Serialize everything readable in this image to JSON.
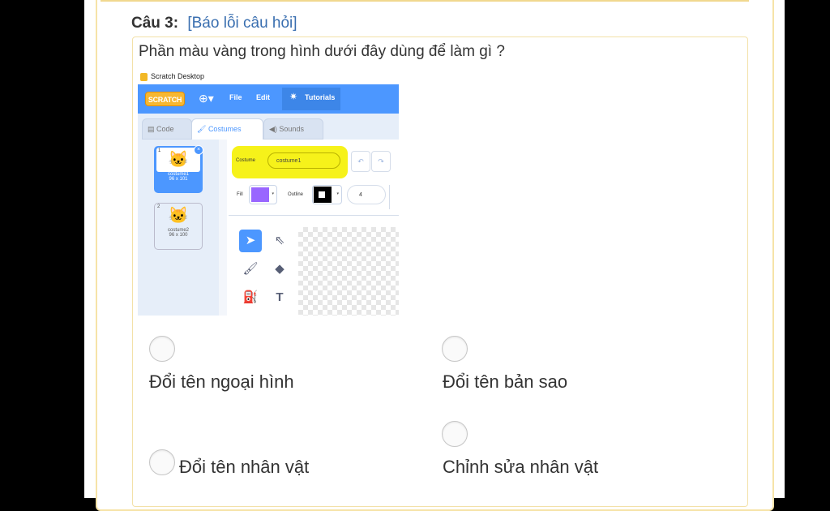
{
  "question": {
    "number_label": "Câu 3:",
    "report_link": "[Báo lỗi câu hỏi]",
    "text": "Phần màu vàng trong hình dưới đây dùng để làm gì ?"
  },
  "scratch": {
    "window_title": "Scratch Desktop",
    "logo": "SCRATCH",
    "menu": {
      "file": "File",
      "edit": "Edit",
      "tutorials": "Tutorials"
    },
    "tabs": {
      "code": "Code",
      "costumes": "Costumes",
      "sounds": "Sounds"
    },
    "costumes": [
      {
        "number": "1",
        "name": "costume1",
        "size": "96 x 101"
      },
      {
        "number": "2",
        "name": "costume2",
        "size": "96 x 100"
      }
    ],
    "costume_label": "Costume",
    "costume_name_value": "costume1",
    "fill_label": "Fill",
    "outline_label": "Outline",
    "outline_width": "4",
    "colors": {
      "fill": "#9966ff",
      "highlight": "#f6f21a",
      "accent": "#4c97ff"
    }
  },
  "answers": [
    {
      "label": "Đổi tên ngoại hình"
    },
    {
      "label": "Đổi tên bản sao"
    },
    {
      "label": "Đổi tên nhân vật"
    },
    {
      "label": "Chỉnh sửa nhân vật"
    }
  ]
}
